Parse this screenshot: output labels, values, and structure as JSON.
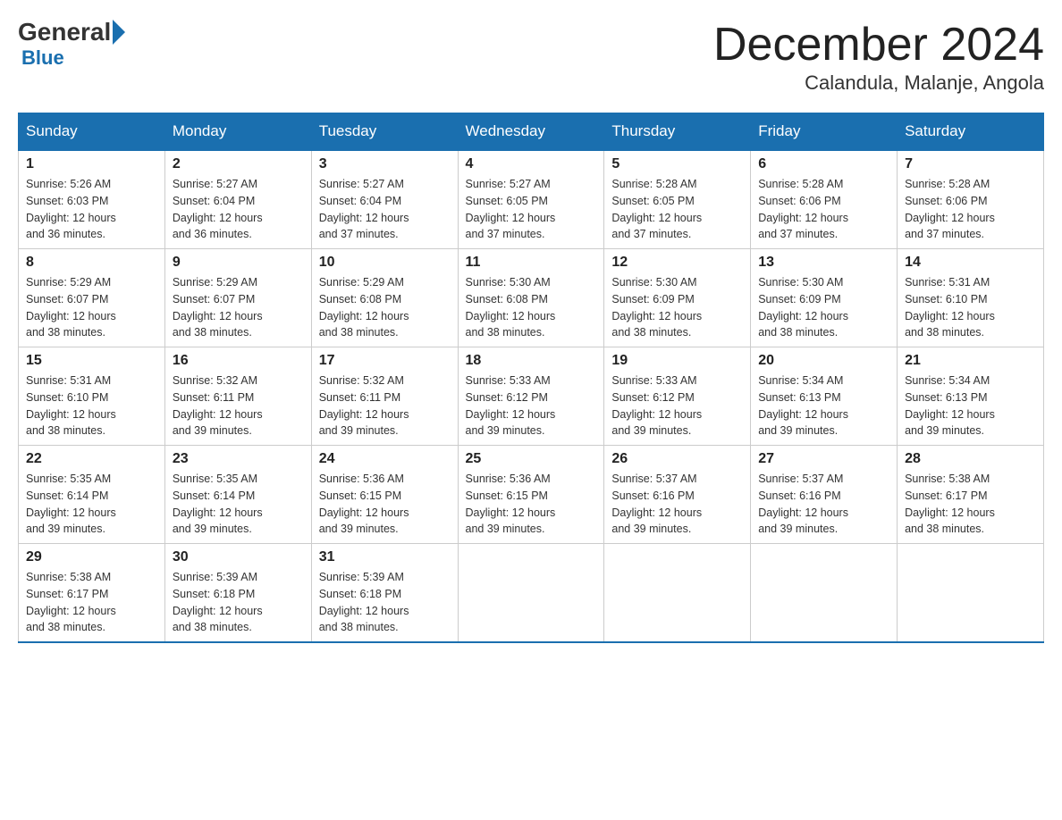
{
  "logo": {
    "general": "General",
    "blue": "Blue"
  },
  "header": {
    "month_year": "December 2024",
    "location": "Calandula, Malanje, Angola"
  },
  "days_of_week": [
    "Sunday",
    "Monday",
    "Tuesday",
    "Wednesday",
    "Thursday",
    "Friday",
    "Saturday"
  ],
  "weeks": [
    [
      {
        "day": "1",
        "sunrise": "5:26 AM",
        "sunset": "6:03 PM",
        "daylight": "12 hours and 36 minutes."
      },
      {
        "day": "2",
        "sunrise": "5:27 AM",
        "sunset": "6:04 PM",
        "daylight": "12 hours and 36 minutes."
      },
      {
        "day": "3",
        "sunrise": "5:27 AM",
        "sunset": "6:04 PM",
        "daylight": "12 hours and 37 minutes."
      },
      {
        "day": "4",
        "sunrise": "5:27 AM",
        "sunset": "6:05 PM",
        "daylight": "12 hours and 37 minutes."
      },
      {
        "day": "5",
        "sunrise": "5:28 AM",
        "sunset": "6:05 PM",
        "daylight": "12 hours and 37 minutes."
      },
      {
        "day": "6",
        "sunrise": "5:28 AM",
        "sunset": "6:06 PM",
        "daylight": "12 hours and 37 minutes."
      },
      {
        "day": "7",
        "sunrise": "5:28 AM",
        "sunset": "6:06 PM",
        "daylight": "12 hours and 37 minutes."
      }
    ],
    [
      {
        "day": "8",
        "sunrise": "5:29 AM",
        "sunset": "6:07 PM",
        "daylight": "12 hours and 38 minutes."
      },
      {
        "day": "9",
        "sunrise": "5:29 AM",
        "sunset": "6:07 PM",
        "daylight": "12 hours and 38 minutes."
      },
      {
        "day": "10",
        "sunrise": "5:29 AM",
        "sunset": "6:08 PM",
        "daylight": "12 hours and 38 minutes."
      },
      {
        "day": "11",
        "sunrise": "5:30 AM",
        "sunset": "6:08 PM",
        "daylight": "12 hours and 38 minutes."
      },
      {
        "day": "12",
        "sunrise": "5:30 AM",
        "sunset": "6:09 PM",
        "daylight": "12 hours and 38 minutes."
      },
      {
        "day": "13",
        "sunrise": "5:30 AM",
        "sunset": "6:09 PM",
        "daylight": "12 hours and 38 minutes."
      },
      {
        "day": "14",
        "sunrise": "5:31 AM",
        "sunset": "6:10 PM",
        "daylight": "12 hours and 38 minutes."
      }
    ],
    [
      {
        "day": "15",
        "sunrise": "5:31 AM",
        "sunset": "6:10 PM",
        "daylight": "12 hours and 38 minutes."
      },
      {
        "day": "16",
        "sunrise": "5:32 AM",
        "sunset": "6:11 PM",
        "daylight": "12 hours and 39 minutes."
      },
      {
        "day": "17",
        "sunrise": "5:32 AM",
        "sunset": "6:11 PM",
        "daylight": "12 hours and 39 minutes."
      },
      {
        "day": "18",
        "sunrise": "5:33 AM",
        "sunset": "6:12 PM",
        "daylight": "12 hours and 39 minutes."
      },
      {
        "day": "19",
        "sunrise": "5:33 AM",
        "sunset": "6:12 PM",
        "daylight": "12 hours and 39 minutes."
      },
      {
        "day": "20",
        "sunrise": "5:34 AM",
        "sunset": "6:13 PM",
        "daylight": "12 hours and 39 minutes."
      },
      {
        "day": "21",
        "sunrise": "5:34 AM",
        "sunset": "6:13 PM",
        "daylight": "12 hours and 39 minutes."
      }
    ],
    [
      {
        "day": "22",
        "sunrise": "5:35 AM",
        "sunset": "6:14 PM",
        "daylight": "12 hours and 39 minutes."
      },
      {
        "day": "23",
        "sunrise": "5:35 AM",
        "sunset": "6:14 PM",
        "daylight": "12 hours and 39 minutes."
      },
      {
        "day": "24",
        "sunrise": "5:36 AM",
        "sunset": "6:15 PM",
        "daylight": "12 hours and 39 minutes."
      },
      {
        "day": "25",
        "sunrise": "5:36 AM",
        "sunset": "6:15 PM",
        "daylight": "12 hours and 39 minutes."
      },
      {
        "day": "26",
        "sunrise": "5:37 AM",
        "sunset": "6:16 PM",
        "daylight": "12 hours and 39 minutes."
      },
      {
        "day": "27",
        "sunrise": "5:37 AM",
        "sunset": "6:16 PM",
        "daylight": "12 hours and 39 minutes."
      },
      {
        "day": "28",
        "sunrise": "5:38 AM",
        "sunset": "6:17 PM",
        "daylight": "12 hours and 38 minutes."
      }
    ],
    [
      {
        "day": "29",
        "sunrise": "5:38 AM",
        "sunset": "6:17 PM",
        "daylight": "12 hours and 38 minutes."
      },
      {
        "day": "30",
        "sunrise": "5:39 AM",
        "sunset": "6:18 PM",
        "daylight": "12 hours and 38 minutes."
      },
      {
        "day": "31",
        "sunrise": "5:39 AM",
        "sunset": "6:18 PM",
        "daylight": "12 hours and 38 minutes."
      },
      null,
      null,
      null,
      null
    ]
  ],
  "labels": {
    "sunrise": "Sunrise:",
    "sunset": "Sunset:",
    "daylight": "Daylight:"
  }
}
